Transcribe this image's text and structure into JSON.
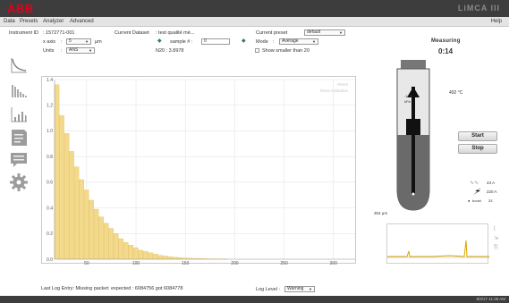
{
  "app": {
    "logo": "ABB",
    "title": "LiMCA III"
  },
  "menu": {
    "items": [
      "Data",
      "Presets",
      "Analyzer",
      "Advanced"
    ],
    "help": "Help"
  },
  "header": {
    "instrument_label": "Instrument ID",
    "instrument_value": ": 1572771-001",
    "dataset_label": "Current Dataset",
    "dataset_value": ": test qualité mé...",
    "preset_label": "Current preset",
    "preset_value": "default",
    "xaxis_label": "x axis",
    "xaxis_value": "5",
    "xaxis_unit": "μm",
    "units_label": "Units",
    "units_value": "ANS",
    "sample_label": "sample # :",
    "sample_value": "0",
    "n20": "N20 : 3.8978",
    "mode_label": "Mode",
    "mode_value": "Average",
    "show_smaller": "Show smaller than 20"
  },
  "chart_overlay": {
    "reset": "Reset",
    "show_validation": "Show validation"
  },
  "chart_data": {
    "type": "bar",
    "bin_width": 5,
    "x_start": 17.5,
    "x_ticks": [
      50,
      100,
      150,
      200,
      250,
      300
    ],
    "y_ticks": [
      0.0,
      0.2,
      0.4,
      0.6,
      0.8,
      1.0,
      1.2,
      1.4
    ],
    "xlim": [
      17.5,
      322
    ],
    "ylim": [
      0,
      1.4
    ],
    "bar_color": "#f3d98c",
    "values": [
      1.36,
      1.12,
      0.98,
      0.84,
      0.72,
      0.62,
      0.54,
      0.46,
      0.39,
      0.33,
      0.28,
      0.24,
      0.2,
      0.16,
      0.13,
      0.11,
      0.09,
      0.07,
      0.06,
      0.05,
      0.04,
      0.03,
      0.025,
      0.02,
      0.016,
      0.012,
      0.01,
      0.008,
      0.006,
      0.005,
      0.004,
      0.003,
      0.003,
      0.002,
      0.002
    ]
  },
  "right_panel": {
    "measuring": "Measuring",
    "timer": "0:14",
    "pressure_value": "-17.5",
    "pressure_unit": "kPa",
    "temperature": "492 °C",
    "depth": "304 μm",
    "start": "Start",
    "stop": "Stop",
    "current_1": "43 A",
    "current_2": "220 A",
    "boost_label": "boost",
    "boost_value": "33"
  },
  "status": {
    "last_log": "Last Log Entry:  Missing packet: expected : 6084756 got 6084778",
    "log_level_label": "Log Level :",
    "log_level_value": "Warning",
    "clock": "8/3/17  11:38 AM"
  }
}
